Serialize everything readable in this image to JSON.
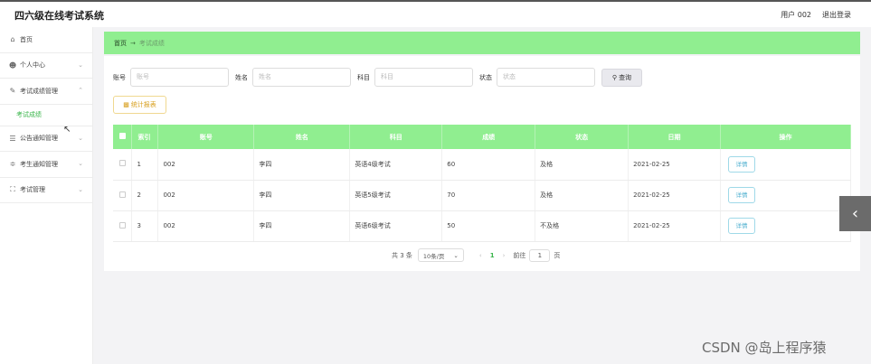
{
  "header": {
    "title": "四六级在线考试系统",
    "user": "用户 002",
    "logout": "退出登录"
  },
  "sidebar": {
    "items": [
      {
        "label": "首页",
        "icon": "home-icon",
        "glyph": "⌂"
      },
      {
        "label": "个人中心",
        "icon": "user-icon",
        "glyph": "👤"
      },
      {
        "label": "考试成绩管理",
        "icon": "score-icon",
        "glyph": "✎"
      },
      {
        "label": "考试成绩"
      },
      {
        "label": "公告通知管理",
        "icon": "notice-icon",
        "glyph": "☰"
      },
      {
        "label": "考生通知管理",
        "icon": "settings-icon",
        "glyph": "≑"
      },
      {
        "label": "考试管理",
        "icon": "exam-icon",
        "glyph": "⛶"
      }
    ]
  },
  "breadcrumb": {
    "home": "首页",
    "current": "考试成绩"
  },
  "search": {
    "fields": [
      {
        "label": "账号",
        "placeholder": "账号"
      },
      {
        "label": "姓名",
        "placeholder": "姓名"
      },
      {
        "label": "科目",
        "placeholder": "科目"
      },
      {
        "label": "状态",
        "placeholder": "状态"
      }
    ],
    "button": "查询"
  },
  "report_button": "统计报表",
  "table": {
    "columns": [
      "索引",
      "账号",
      "姓名",
      "科目",
      "成绩",
      "状态",
      "日期",
      "操作"
    ],
    "rows": [
      {
        "index": "1",
        "account": "002",
        "name": "李四",
        "subject": "英语4级考试",
        "score": "60",
        "status": "及格",
        "date": "2021-02-25",
        "action": "详情"
      },
      {
        "index": "2",
        "account": "002",
        "name": "李四",
        "subject": "英语5级考试",
        "score": "70",
        "status": "及格",
        "date": "2021-02-25",
        "action": "详情"
      },
      {
        "index": "3",
        "account": "002",
        "name": "李四",
        "subject": "英语6级考试",
        "score": "50",
        "status": "不及格",
        "date": "2021-02-25",
        "action": "详情"
      }
    ]
  },
  "pagination": {
    "total": "共 3 条",
    "page_size": "10条/页",
    "current": "1",
    "goto": "前往",
    "goto_value": "1",
    "unit": "页"
  },
  "watermark": "CSDN @岛上程序猿"
}
